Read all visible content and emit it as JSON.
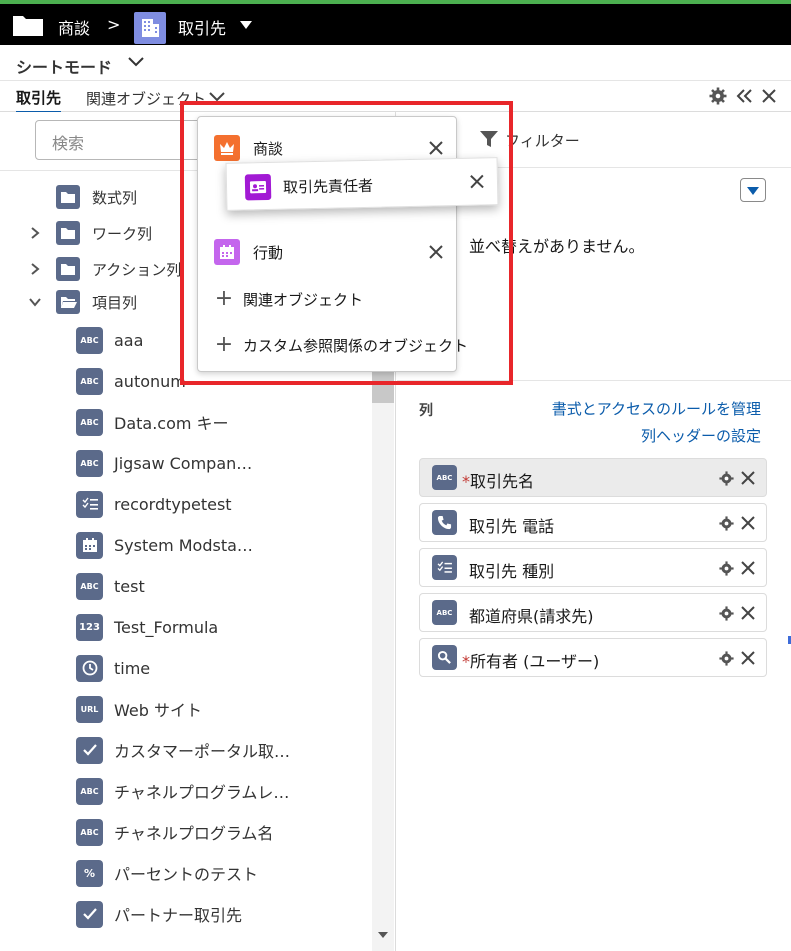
{
  "topbar": {
    "app_label": "商談",
    "separator": ">",
    "object_label": "取引先",
    "colors": {
      "background": "#000000",
      "object_icon": "#7f8de1",
      "accent_strip": "#4caf50"
    }
  },
  "mode": {
    "label": "シートモード"
  },
  "tabs": [
    {
      "label": "取引先",
      "active": true
    },
    {
      "label": "関連オブジェクト",
      "active": false
    }
  ],
  "search": {
    "placeholder": "検索"
  },
  "tree": {
    "folders": [
      {
        "label": "数式列",
        "expanded": false,
        "has_chevron": false,
        "icon": "folder-icon"
      },
      {
        "label": "ワーク列",
        "expanded": false,
        "has_chevron": true,
        "icon": "folder-icon"
      },
      {
        "label": "アクション列",
        "expanded": false,
        "has_chevron": true,
        "icon": "folder-icon"
      },
      {
        "label": "項目列",
        "expanded": true,
        "has_chevron": true,
        "icon": "folder-open-icon"
      }
    ],
    "fields": [
      {
        "label": "aaa",
        "icon_text": "ABC",
        "icon": "text-icon"
      },
      {
        "label": "autonum",
        "icon_text": "ABC",
        "icon": "text-icon"
      },
      {
        "label": "Data.com キー",
        "icon_text": "ABC",
        "icon": "text-icon"
      },
      {
        "label": "Jigsaw Compan…",
        "icon_text": "ABC",
        "icon": "text-icon"
      },
      {
        "label": "recordtypetest",
        "icon_text": "",
        "icon": "picklist-icon"
      },
      {
        "label": "System Modsta…",
        "icon_text": "",
        "icon": "calendar-icon"
      },
      {
        "label": "test",
        "icon_text": "ABC",
        "icon": "text-icon"
      },
      {
        "label": "Test_Formula",
        "icon_text": "123",
        "icon": "number-icon"
      },
      {
        "label": "time",
        "icon_text": "",
        "icon": "clock-icon"
      },
      {
        "label": "Web サイト",
        "icon_text": "URL",
        "icon": "url-icon"
      },
      {
        "label": "カスタマーポータル取…",
        "icon_text": "",
        "icon": "checkbox-icon"
      },
      {
        "label": "チャネルプログラムレ…",
        "icon_text": "ABC",
        "icon": "text-icon"
      },
      {
        "label": "チャネルプログラム名",
        "icon_text": "ABC",
        "icon": "text-icon"
      },
      {
        "label": "パーセントのテスト",
        "icon_text": "%",
        "icon": "percent-icon"
      },
      {
        "label": "パートナー取引先",
        "icon_text": "",
        "icon": "checkbox-icon"
      }
    ]
  },
  "filter": {
    "label": "フィルター"
  },
  "sort": {
    "empty_text": "並べ替えがありません。"
  },
  "columns": {
    "title": "列",
    "manage_rules_link": "書式とアクセスのルールを管理",
    "header_settings_link": "列ヘッダーの設定",
    "items": [
      {
        "label": "取引先名",
        "required": true,
        "icon_text": "ABC",
        "icon": "text-icon"
      },
      {
        "label": "取引先 電話",
        "required": false,
        "icon_text": "",
        "icon": "phone-icon"
      },
      {
        "label": "取引先 種別",
        "required": false,
        "icon_text": "",
        "icon": "picklist-icon"
      },
      {
        "label": "都道府県(請求先)",
        "required": false,
        "icon_text": "ABC",
        "icon": "text-icon"
      },
      {
        "label": "所有者 (ユーザー)",
        "required": true,
        "icon_text": "",
        "icon": "lookup-icon"
      }
    ]
  },
  "related_popup": {
    "items": [
      {
        "label": "商談",
        "icon": "crown-icon",
        "color": "#f4702f"
      },
      {
        "label": "行動",
        "icon": "calendar-icon",
        "color": "#c466ed"
      }
    ],
    "add_related": "関連オブジェクト",
    "add_custom": "カスタム参照関係のオブジェクト",
    "highlight_color": "#e8262a"
  },
  "drag_card": {
    "label": "取引先責任者",
    "icon": "contact-card-icon",
    "color": "#a21ad4"
  }
}
